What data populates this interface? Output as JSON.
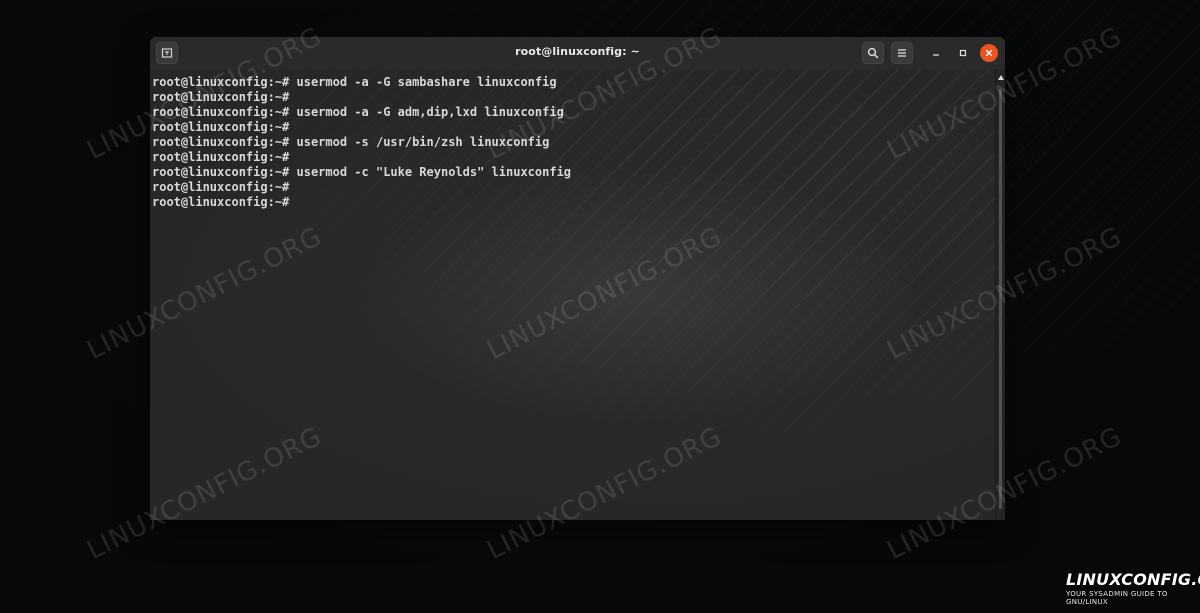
{
  "window": {
    "title": "root@linuxconfig: ~",
    "accent_close_color": "#e95420"
  },
  "terminal": {
    "lines": [
      "root@linuxconfig:~# usermod -a -G sambashare linuxconfig",
      "root@linuxconfig:~#",
      "root@linuxconfig:~# usermod -a -G adm,dip,lxd linuxconfig",
      "root@linuxconfig:~#",
      "root@linuxconfig:~# usermod -s /usr/bin/zsh linuxconfig",
      "root@linuxconfig:~#",
      "root@linuxconfig:~# usermod -c \"Luke Reynolds\" linuxconfig",
      "root@linuxconfig:~#",
      "root@linuxconfig:~#"
    ]
  },
  "watermark": {
    "text": "LINUXCONFIG.ORG"
  },
  "logo": {
    "main": "LINUXCONFIG.ORG",
    "tagline": "YOUR SYSADMIN GUIDE TO GNU/LINUX"
  },
  "icons": {
    "tab": "new-tab-icon",
    "search": "search-icon",
    "menu": "hamburger-menu-icon",
    "minimize": "minimize-icon",
    "maximize": "maximize-icon",
    "close": "close-icon"
  }
}
